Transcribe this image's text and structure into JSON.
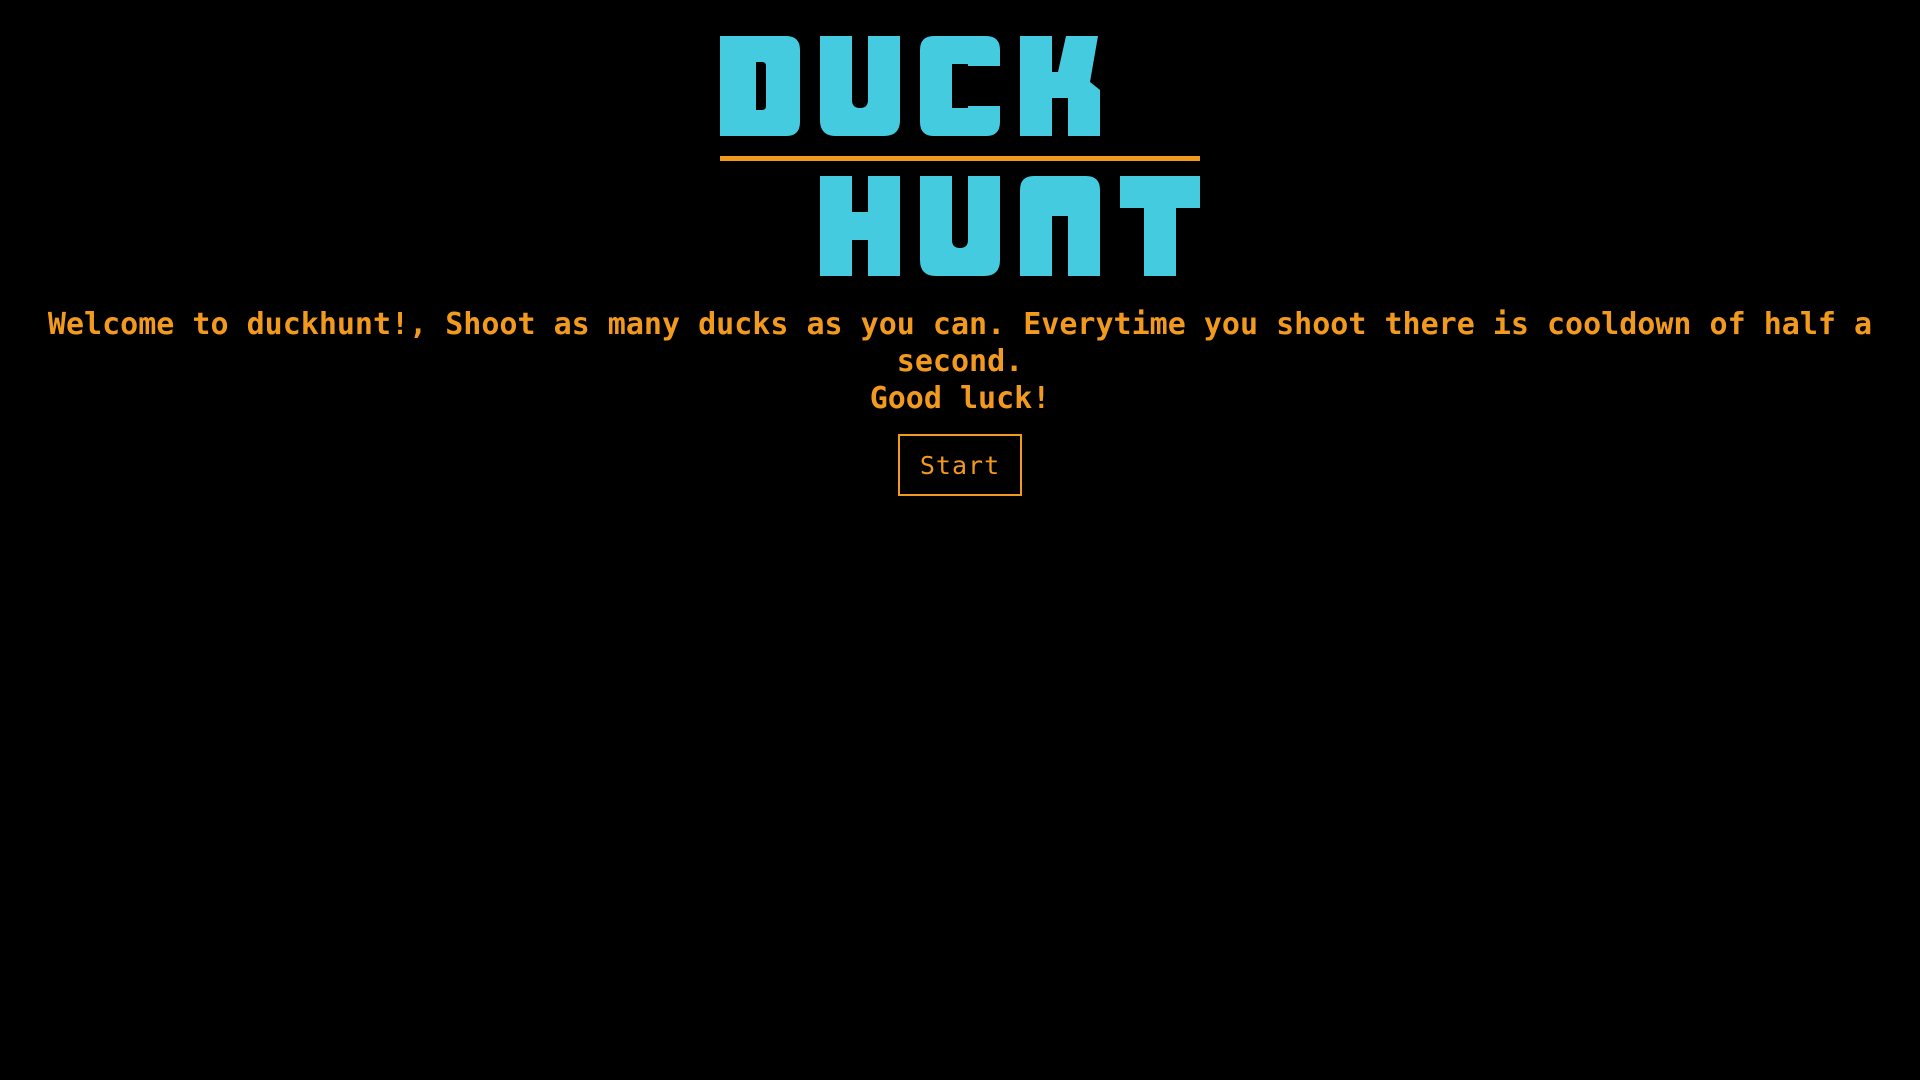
{
  "logo": {
    "word_top": "DUCK",
    "word_bottom": "HUNT",
    "letter_color": "#45cbe0",
    "rule_color": "#f29a1e"
  },
  "intro": {
    "line1": "Welcome to duckhunt!, Shoot as many ducks as you can. Everytime you shoot there is cooldown of half a second.",
    "line2": "Good luck!"
  },
  "start_button": {
    "label": "Start"
  },
  "colors": {
    "background": "#000000",
    "accent": "#f29a1e"
  }
}
